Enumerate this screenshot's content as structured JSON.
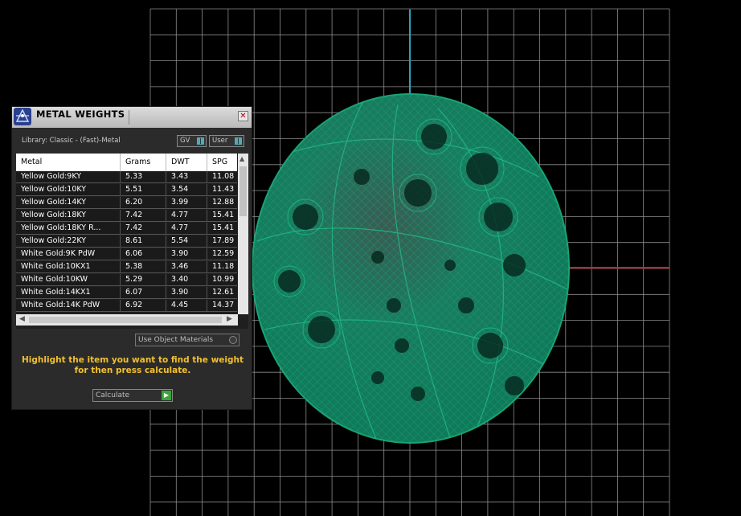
{
  "colors": {
    "grid": "#8c8c8c",
    "axis_blue": "#2aa2b4",
    "axis_red": "#c0282a",
    "mesh_green": "#0f8a64",
    "hint_yellow": "#f2c12e"
  },
  "panel": {
    "title": "METAL WEIGHTS",
    "close_icon": "close-x",
    "logo_icon": "metal-weights-logo",
    "library": "Library: Classic - (Fast)-Metal",
    "toggle_gv": "GV",
    "toggle_user": "User",
    "table": {
      "columns": [
        "Metal",
        "Grams",
        "DWT",
        "SPG"
      ],
      "rows": [
        [
          "Yellow Gold:9KY",
          "5.33",
          "3.43",
          "11.08"
        ],
        [
          "Yellow Gold:10KY",
          "5.51",
          "3.54",
          "11.43"
        ],
        [
          "Yellow Gold:14KY",
          "6.20",
          "3.99",
          "12.88"
        ],
        [
          "Yellow Gold:18KY",
          "7.42",
          "4.77",
          "15.41"
        ],
        [
          "Yellow Gold:18KY R...",
          "7.42",
          "4.77",
          "15.41"
        ],
        [
          "Yellow Gold:22KY",
          "8.61",
          "5.54",
          "17.89"
        ],
        [
          "White Gold:9K PdW",
          "6.06",
          "3.90",
          "12.59"
        ],
        [
          "White Gold:10KX1",
          "5.38",
          "3.46",
          "11.18"
        ],
        [
          "White Gold:10KW",
          "5.29",
          "3.40",
          "10.99"
        ],
        [
          "White Gold:14KX1",
          "6.07",
          "3.90",
          "12.61"
        ],
        [
          "White Gold:14K PdW",
          "6.92",
          "4.45",
          "14.37"
        ]
      ]
    },
    "use_object_materials": "Use Object Materials",
    "hint": "Highlight the item you want to find the weight for then press calculate.",
    "calculate": "Calculate"
  }
}
